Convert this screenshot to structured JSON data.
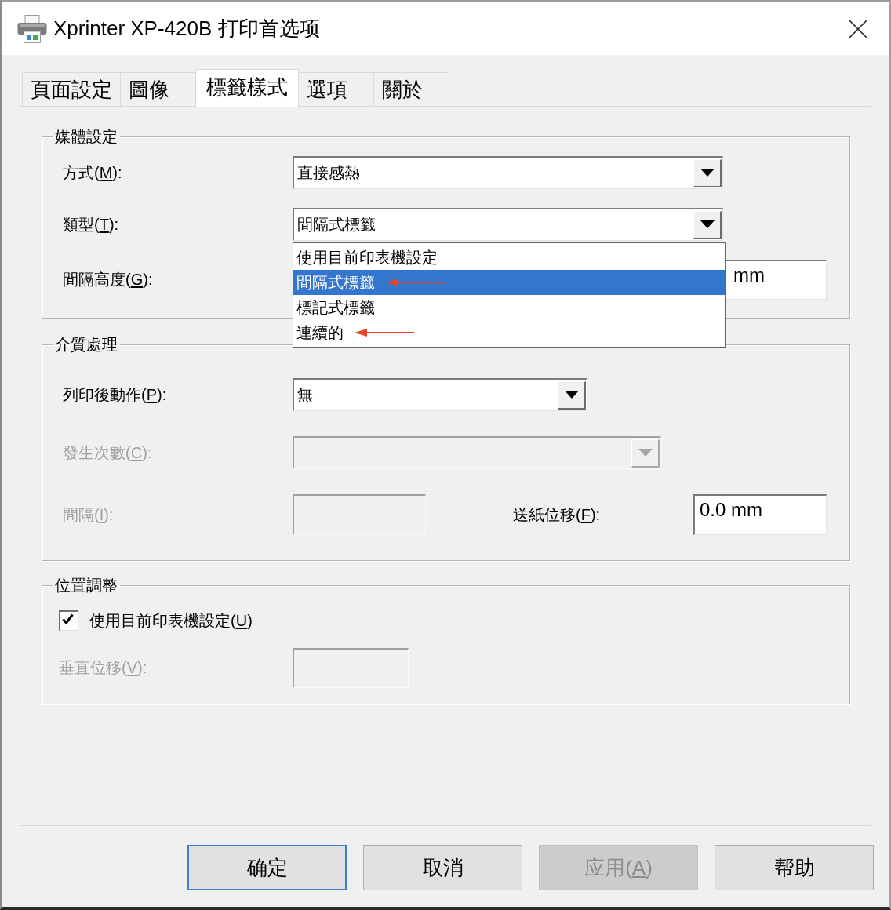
{
  "window": {
    "title": "Xprinter XP-420B 打印首选项"
  },
  "tabs": [
    {
      "label": "頁面設定",
      "selected": false
    },
    {
      "label": "圖像",
      "selected": false
    },
    {
      "label": "標籤樣式",
      "selected": true
    },
    {
      "label": "選項",
      "selected": false
    },
    {
      "label": "關於",
      "selected": false
    }
  ],
  "media_settings": {
    "legend": "媒體設定",
    "method": {
      "label": {
        "text": "方式(",
        "key": "M",
        "rest": "):"
      },
      "value": "直接感熱",
      "disabled": false
    },
    "type": {
      "label": {
        "text": "類型(",
        "key": "T",
        "rest": "):"
      },
      "value": "間隔式標籤",
      "disabled": false,
      "expanded": true,
      "options": [
        {
          "text": "使用目前印表機設定",
          "selected": false,
          "arrow": false
        },
        {
          "text": "間隔式標籤",
          "selected": true,
          "arrow": true
        },
        {
          "text": "標記式標籤",
          "selected": false,
          "arrow": false
        },
        {
          "text": "連續的",
          "selected": false,
          "arrow": true
        }
      ]
    },
    "gap_height": {
      "label": {
        "text": "間隔高度(",
        "key": "G",
        "rest": "):"
      },
      "value": "mm",
      "disabled": false
    }
  },
  "media_handling": {
    "legend": "介質處理",
    "post_print_action": {
      "label": {
        "text": "列印後動作(",
        "key": "P",
        "rest": "):"
      },
      "value": "無",
      "disabled": false
    },
    "occurrences": {
      "label": {
        "text": "發生次數(",
        "key": "C",
        "rest": "):"
      },
      "disabled": true
    },
    "interval": {
      "label": {
        "text": "間隔(",
        "key": "I",
        "rest": "):"
      },
      "disabled": true
    },
    "feed_offset": {
      "label": {
        "text": "送紙位移(",
        "key": "F",
        "rest": "):"
      },
      "value": "0.0 mm",
      "disabled": false
    }
  },
  "position_adjustment": {
    "legend": "位置調整",
    "use_printer_settings": {
      "label": {
        "text": "使用目前印表機設定(",
        "key": "U",
        "rest": ")"
      },
      "checked": true
    },
    "vertical_offset": {
      "label": {
        "text": "垂直位移(",
        "key": "V",
        "rest": "):"
      },
      "disabled": true
    }
  },
  "buttons": [
    {
      "label": {
        "text": "确定"
      },
      "focused": true,
      "disabled": false
    },
    {
      "label": {
        "text": "取消"
      },
      "focused": false,
      "disabled": false
    },
    {
      "label": {
        "text": "应用(",
        "key": "A",
        "rest": ")"
      },
      "focused": false,
      "disabled": true
    },
    {
      "label": {
        "text": "帮助"
      },
      "focused": false,
      "disabled": false
    }
  ]
}
